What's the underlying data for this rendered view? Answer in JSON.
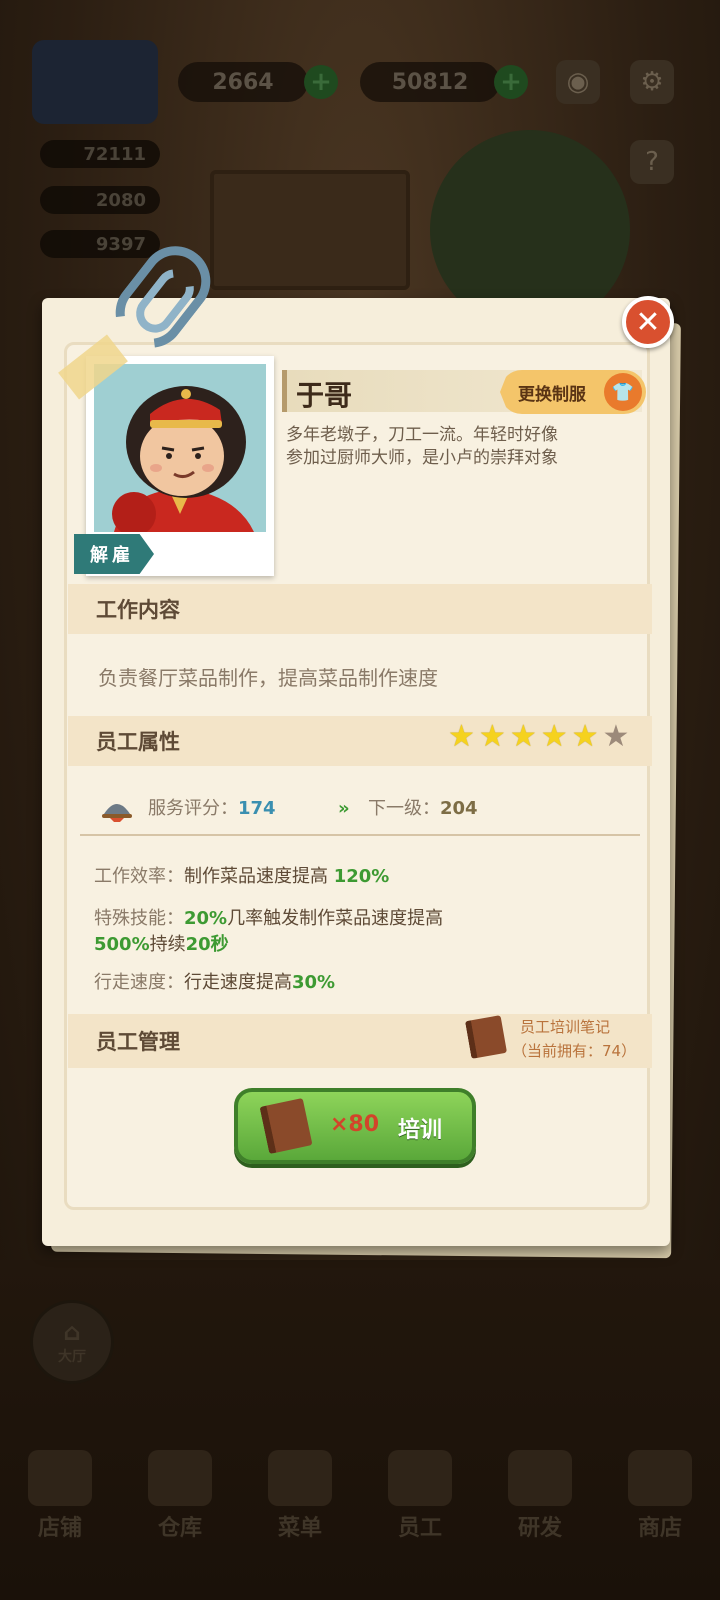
{
  "topbar": {
    "gem_count": "2664",
    "cash_count": "50812",
    "resources": [
      "72111",
      "2080",
      "9397"
    ]
  },
  "employee": {
    "name": "于哥",
    "description": "多年老墩子，刀工一流。年轻时好像参加过厨师大师，是小卢的崇拜对象",
    "fire_label": "解雇",
    "uniform_label": "更换制服",
    "uniform_icon": "shirt-icon"
  },
  "work": {
    "title": "工作内容",
    "content": "负责餐厅菜品制作，提高菜品制作速度"
  },
  "attributes": {
    "title": "员工属性",
    "stars_filled": 5,
    "stars_total": 6,
    "service_label": "服务评分：",
    "service_value": "174",
    "next_label": "下一级：",
    "next_value": "204",
    "efficiency_label": "工作效率：",
    "efficiency_text": "制作菜品速度提高",
    "efficiency_value": "120%",
    "skill_label": "特殊技能：",
    "skill_value_1": "20%",
    "skill_text_1": "几率触发制作菜品速度提高",
    "skill_value_2": "500%",
    "skill_text_2": "持续",
    "skill_value_3": "20秒",
    "walk_label": "行走速度：",
    "walk_text": "行走速度提高",
    "walk_value": "30%"
  },
  "management": {
    "title": "员工管理",
    "notes_label": "员工培训笔记",
    "notes_owned": "（当前拥有：74）",
    "train_cost": "×80",
    "train_label": "培训"
  },
  "side_buttons": {
    "hall": "大厅"
  },
  "bottom_nav": [
    "店铺",
    "仓库",
    "菜单",
    "员工",
    "研发",
    "商店"
  ],
  "colors": {
    "accent_green": "#3d9a32",
    "service_blue": "#3a8fb0",
    "close_red": "#d9502f",
    "star_yellow": "#f5d21e"
  }
}
